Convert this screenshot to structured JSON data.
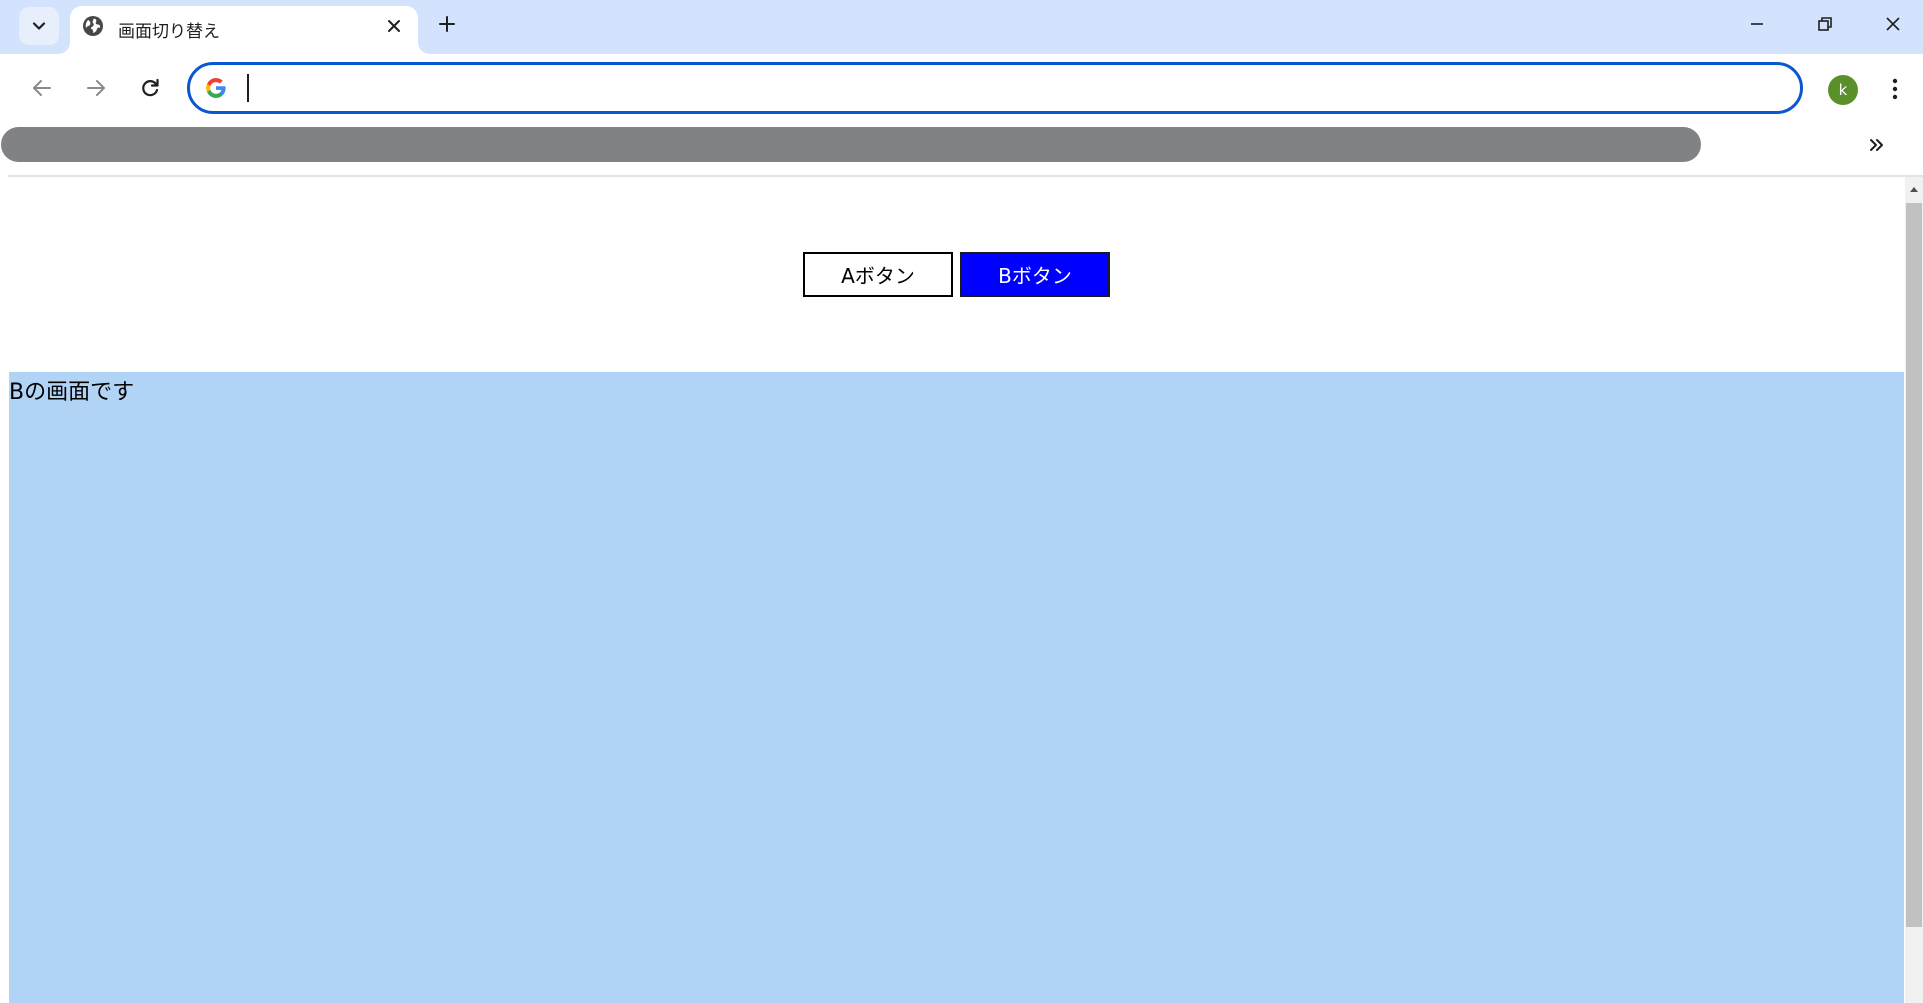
{
  "browser": {
    "tab": {
      "title": "画面切り替え",
      "favicon": "globe-icon"
    },
    "new_tab_icon": "plus-icon",
    "tab_search_icon": "chevron-down-icon",
    "window_controls": [
      "minimize-icon",
      "restore-icon",
      "close-icon"
    ],
    "omnibox": {
      "value": "",
      "placeholder": ""
    },
    "profile": {
      "initial": "k",
      "color": "#5a8f2a"
    },
    "accent_color": "#0b57d0",
    "tabstrip_color": "#d3e3fd"
  },
  "page": {
    "buttons": {
      "a_label": "Aボタン",
      "b_label": "Bボタン"
    },
    "active_screen": "B",
    "screen_b": {
      "text": "Bの画面です",
      "background": "#b1d3f5"
    },
    "colors": {
      "active_button": "#0000ff",
      "inactive_button": "#ffffff"
    }
  }
}
